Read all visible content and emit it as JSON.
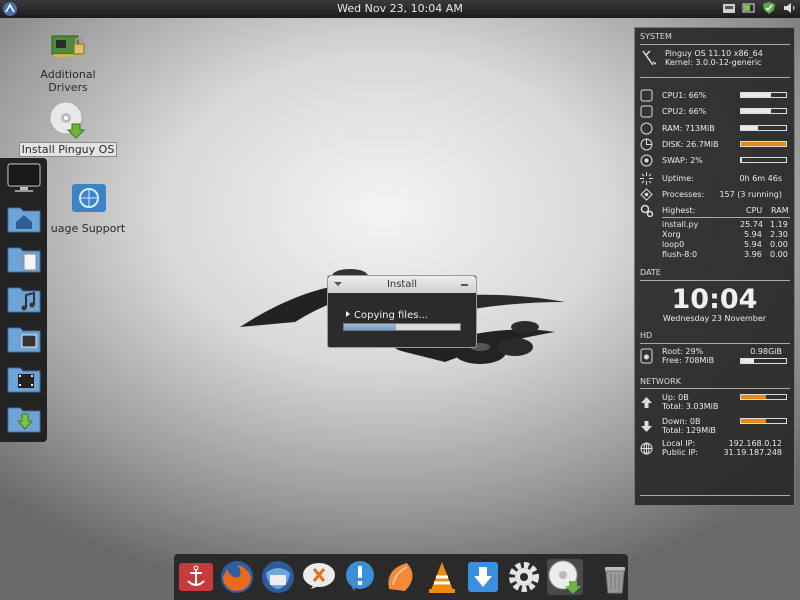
{
  "top_panel": {
    "clock": "Wed Nov 23, 10:04 AM",
    "tray_icons": [
      "network-icon",
      "battery-icon",
      "shield-icon",
      "sound-icon"
    ]
  },
  "desktop_icons": [
    {
      "label": "Additional Drivers",
      "icon": "hardware-card-icon"
    },
    {
      "label": "Install Pinguy OS",
      "icon": "cd-install-icon"
    },
    {
      "label": "uage Support",
      "icon": "language-globe-icon"
    }
  ],
  "side_dock": [
    "monitor-icon",
    "home-folder-icon",
    "documents-folder-icon",
    "music-folder-icon",
    "pictures-folder-icon",
    "videos-folder-icon",
    "downloads-folder-icon"
  ],
  "conky": {
    "system_header": "SYSTEM",
    "os": "Pinguy OS 11.10 x86_64",
    "kernel": "Kernel: 3.0.0-12-generic",
    "cpu1": "CPU1: 66%",
    "cpu2": "CPU2: 66%",
    "ram": "RAM: 713MiB",
    "disk": "DISK: 26.7MiB",
    "swap": "SWAP: 2%",
    "bars": {
      "cpu1": 0.66,
      "cpu2": 0.66,
      "ram": 0.38,
      "disk": 1.0,
      "swap": 0.02
    },
    "uptime_label": "Uptime:",
    "uptime_value": "0h 6m 46s",
    "processes_label": "Processes:",
    "processes_value": "157 (3 running)",
    "highest_label": "Highest:",
    "cpu_col": "CPU",
    "ram_col": "RAM",
    "procs": [
      {
        "name": "install.py",
        "cpu": "25.74",
        "ram": "1.19"
      },
      {
        "name": "Xorg",
        "cpu": "5.94",
        "ram": "2.30"
      },
      {
        "name": "loop0",
        "cpu": "5.94",
        "ram": "0.00"
      },
      {
        "name": "flush-8:0",
        "cpu": "3.96",
        "ram": "0.00"
      }
    ],
    "date_header": "DATE",
    "time": "10:04",
    "date": "Wednesday 23 November",
    "hd_header": "HD",
    "root": "Root: 29%",
    "root_size": "0.98GiB",
    "free": "Free: 708MiB",
    "hd_bar": 0.29,
    "network_header": "NETWORK",
    "up": "Up: 0B",
    "up_total": "Total: 3.03MiB",
    "down": "Down: 0B",
    "down_total": "Total: 129MiB",
    "net_bars": {
      "up": 0.55,
      "down": 0.55
    },
    "local_ip_label": "Local IP:",
    "local_ip": "192.168.0.12",
    "public_ip_label": "Public IP:",
    "public_ip": "31.19.187.248"
  },
  "install_window": {
    "title": "Install",
    "status": "Copying files...",
    "progress": 0.45
  },
  "bottom_dock": [
    "anchor-icon",
    "firefox-icon",
    "thunderbird-icon",
    "pidgin-icon",
    "empathy-icon",
    "clementine-icon",
    "vlc-icon",
    "downloader-icon",
    "settings-gear-icon",
    "cd-install-icon",
    "trash-icon"
  ]
}
